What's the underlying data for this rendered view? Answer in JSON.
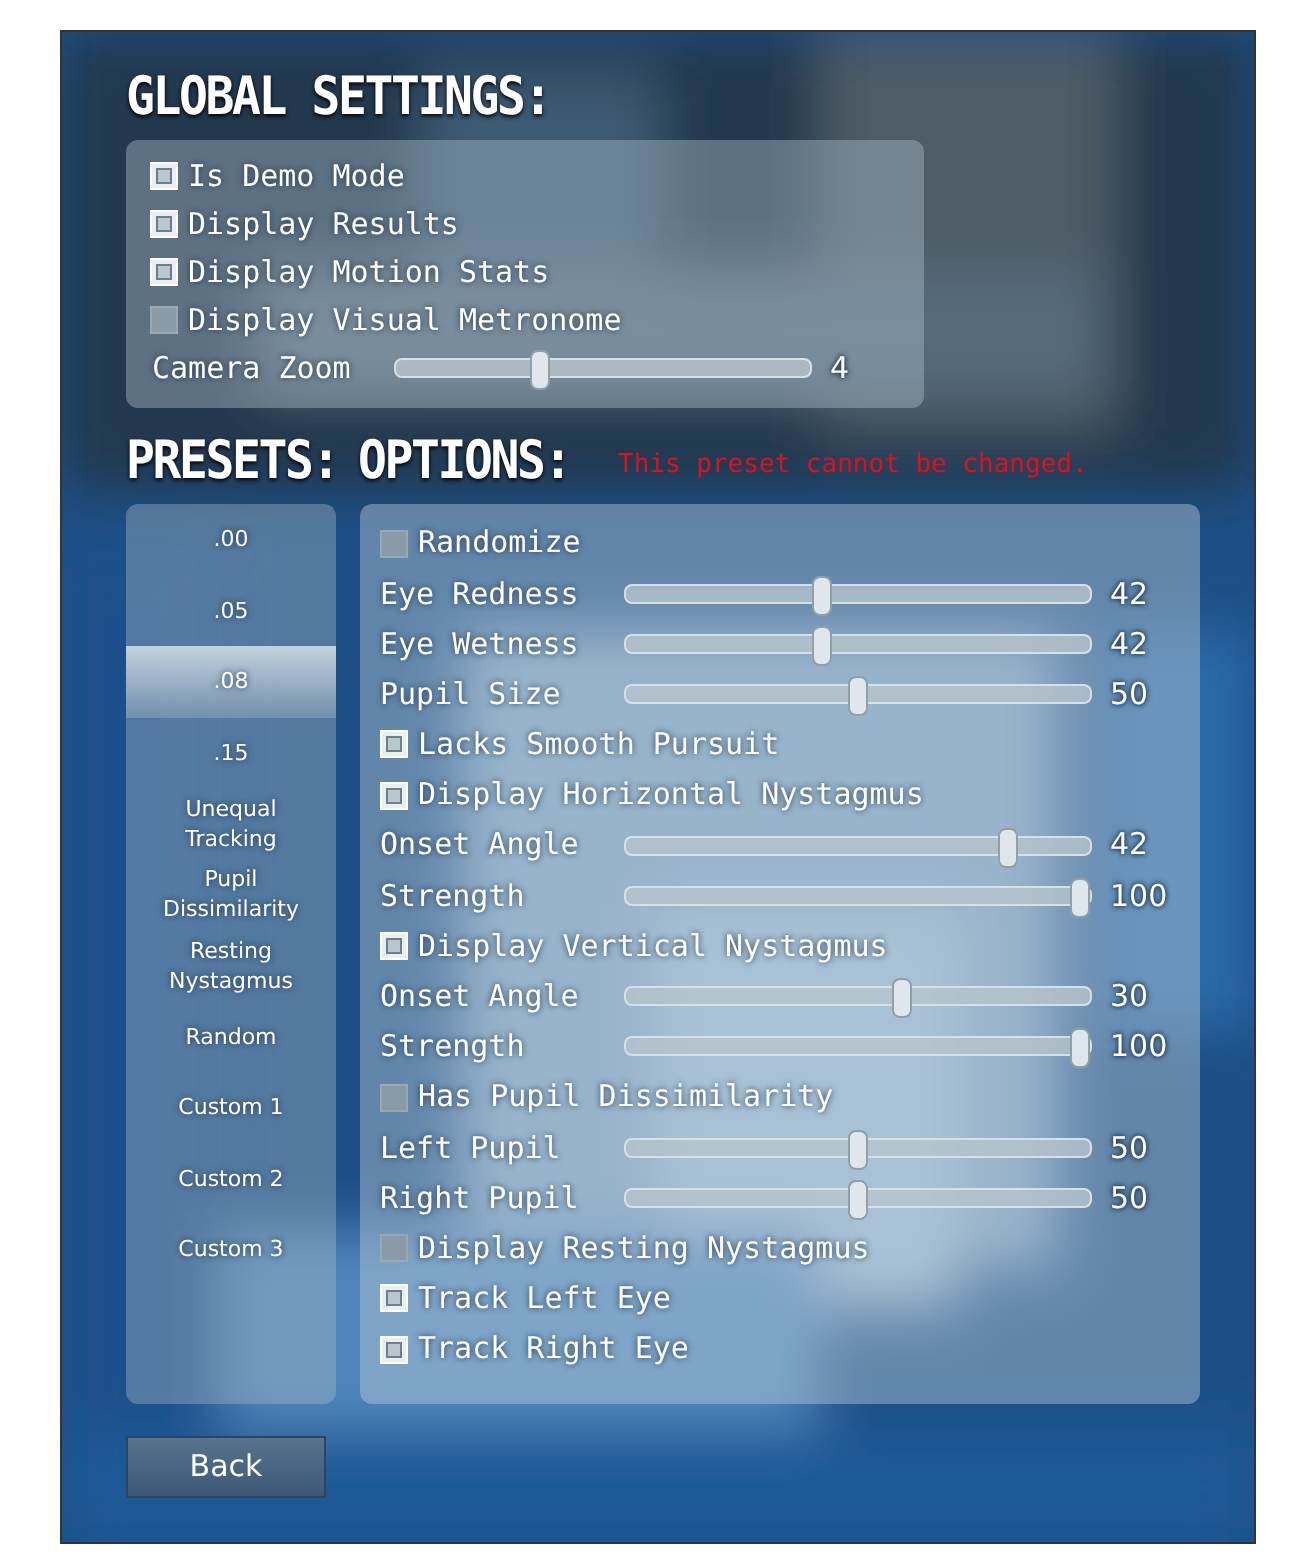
{
  "global_settings": {
    "title": "GLOBAL SETTINGS:",
    "options": [
      {
        "kind": "checkbox",
        "label": "Is Demo Mode",
        "checked": true
      },
      {
        "kind": "checkbox",
        "label": "Display Results",
        "checked": true
      },
      {
        "kind": "checkbox",
        "label": "Display Motion Stats",
        "checked": true
      },
      {
        "kind": "checkbox",
        "label": "Display Visual Metronome",
        "checked": false
      },
      {
        "kind": "slider",
        "label": "Camera Zoom",
        "level": 0.34,
        "reading": "4"
      }
    ]
  },
  "presets": {
    "title": "PRESETS:",
    "items": [
      {
        "label": ".00",
        "selected": false
      },
      {
        "label": ".05",
        "selected": false
      },
      {
        "label": ".08",
        "selected": true
      },
      {
        "label": ".15",
        "selected": false
      },
      {
        "label": "Unequal Tracking",
        "selected": false
      },
      {
        "label": "Pupil Dissimilarity",
        "selected": false
      },
      {
        "label": "Resting Nystagmus",
        "selected": false
      },
      {
        "label": "Random",
        "selected": false
      },
      {
        "label": "Custom 1",
        "selected": false
      },
      {
        "label": "Custom 2",
        "selected": false
      },
      {
        "label": "Custom 3",
        "selected": false
      }
    ]
  },
  "options": {
    "title": "OPTIONS:",
    "message": "This preset cannot be changed.",
    "items": [
      {
        "kind": "checkbox",
        "label": "Randomize",
        "checked": false
      },
      {
        "kind": "slider",
        "label": "Eye Redness",
        "level": 0.42,
        "reading": "42"
      },
      {
        "kind": "slider",
        "label": "Eye Wetness",
        "level": 0.42,
        "reading": "42"
      },
      {
        "kind": "slider",
        "label": "Pupil Size",
        "level": 0.5,
        "reading": "50"
      },
      {
        "kind": "checkbox",
        "label": "Lacks Smooth Pursuit",
        "checked": true
      },
      {
        "kind": "checkbox",
        "label": "Display Horizontal Nystagmus",
        "checked": true
      },
      {
        "kind": "slider",
        "label": "Onset Angle",
        "level": 0.84,
        "reading": "42"
      },
      {
        "kind": "slider",
        "label": "Strength",
        "level": 1,
        "reading": "100"
      },
      {
        "kind": "checkbox",
        "label": "Display Vertical Nystagmus",
        "checked": true
      },
      {
        "kind": "slider",
        "label": "Onset Angle",
        "level": 0.6,
        "reading": "30"
      },
      {
        "kind": "slider",
        "label": "Strength",
        "level": 1,
        "reading": "100"
      },
      {
        "kind": "checkbox",
        "label": "Has Pupil Dissimilarity",
        "checked": false
      },
      {
        "kind": "slider",
        "label": "Left Pupil",
        "level": 0.5,
        "reading": "50"
      },
      {
        "kind": "slider",
        "label": "Right Pupil",
        "level": 0.5,
        "reading": "50"
      },
      {
        "kind": "checkbox",
        "label": "Display Resting Nystagmus",
        "checked": false
      },
      {
        "kind": "checkbox",
        "label": "Track Left Eye",
        "checked": true
      },
      {
        "kind": "checkbox",
        "label": "Track Right Eye",
        "checked": true
      }
    ]
  },
  "back_button": "Back"
}
